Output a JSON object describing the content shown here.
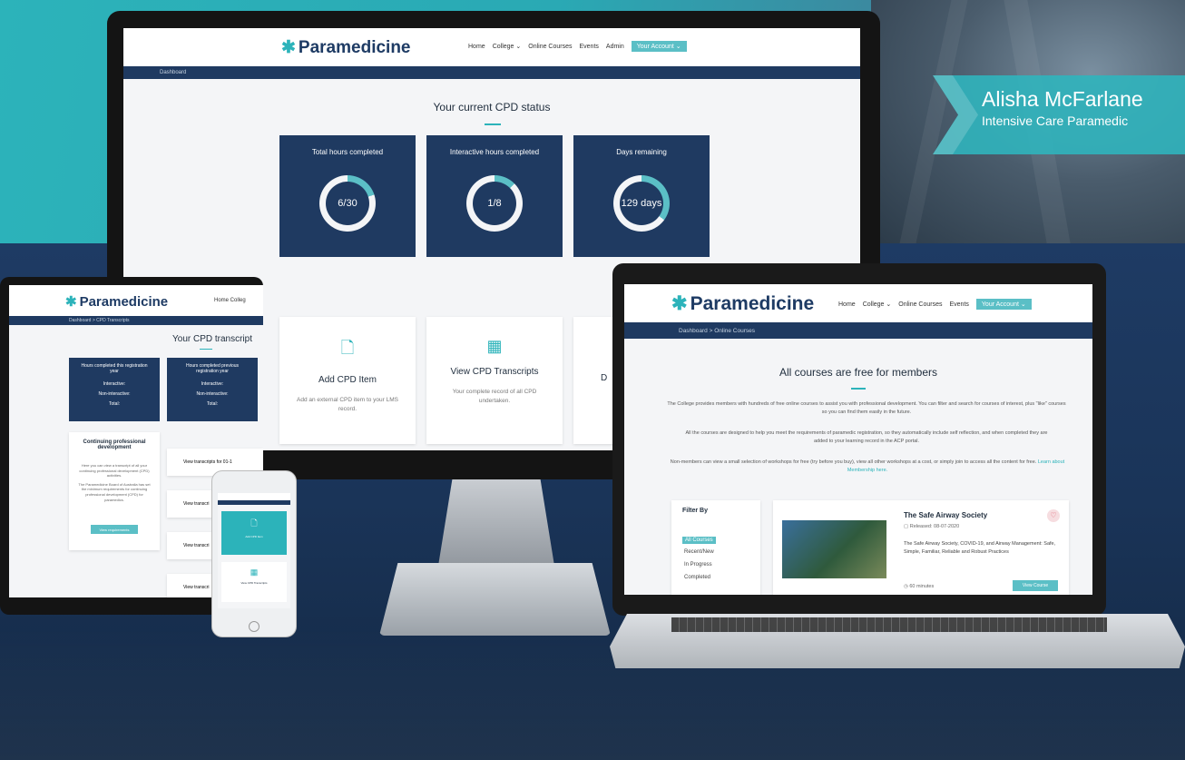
{
  "hero": {
    "name": "Alisha McFarlane",
    "role": "Intensive Care Paramedic"
  },
  "desktop": {
    "logo": "Paramedicine",
    "nav": [
      "Home",
      "College ⌄",
      "Online Courses",
      "Events",
      "Admin"
    ],
    "account": "Your Account ⌄",
    "breadcrumb": "Dashboard",
    "heading": "Your current CPD status",
    "tiles": [
      {
        "title": "Total hours completed",
        "value": "6/30",
        "progress": 0.2
      },
      {
        "title": "Interactive hours completed",
        "value": "1/8",
        "progress": 0.125
      },
      {
        "title": "Days remaining",
        "value": "129 days",
        "progress": 0.35
      }
    ],
    "cards": [
      {
        "title": "Add CPD Item",
        "desc": "Add an external CPD item to your LMS record."
      },
      {
        "title": "View CPD Transcripts",
        "desc": "Your complete record of all CPD undertaken."
      },
      {
        "title": "D",
        "desc": ""
      }
    ]
  },
  "tablet": {
    "logo": "Paramedicine",
    "nav": "Home  Colleg",
    "breadcrumb": "Dashboard  >  CPD Transcripts",
    "heading": "Your CPD transcript",
    "box1": "Hours completed this registration year",
    "box2": "Hours completed previous registration year",
    "rows": [
      "Interactive:",
      "Non-interactive:",
      "Total:"
    ],
    "side_title": "Continuing professional development",
    "side_text1": "Here you can view a transcript of all your continuing professional development (CPD) activities.",
    "side_text2": "The Paramedicine Board of Australia has set the minimum requirements for continuing professional development (CPD) for paramedics.",
    "side_btn": "View requirements",
    "links": [
      "View transcripts for 01-1",
      "View transcri",
      "View transcri",
      "View transcri"
    ]
  },
  "phone": {
    "item1": "Add CPD Item",
    "item2": "View CPD Transcripts"
  },
  "laptop": {
    "logo": "Paramedicine",
    "nav": [
      "Home",
      "College ⌄",
      "Online Courses",
      "Events"
    ],
    "account": "Your Account ⌄",
    "breadcrumb": "Dashboard  >  Online Courses",
    "heading": "All courses are free for members",
    "p1": "The College provides members with hundreds of free online courses to assist you with professional development. You can filter and search for courses of interest, plus \"like\" courses so you can find them easily in the future.",
    "p2": "All the courses are designed to help you meet the requirements of paramedic registration, so they automatically include self reflection, and when completed they are added to your learning record in the ACP portal.",
    "p3": "Non-members can view a small selection of workshops for free (try before you buy), view all other workshops at a cost, or simply join to access all the content for free.",
    "p3_link": "Learn about Membership here.",
    "filter_title": "Filter By",
    "filters": [
      "All Courses",
      "Recent/New",
      "In Progress",
      "Completed"
    ],
    "course_title": "The Safe Airway Society",
    "course_date": "Released: 08-07-2020",
    "course_desc": "The Safe Airway Society, COVID-19, and Airway Management: Safe, Simple, Familiar, Reliable and Robust Practices",
    "course_duration": "60 minutes",
    "course_btn": "View Course"
  },
  "colors": {
    "teal": "#2cb3ba",
    "navy": "#1f3a61"
  }
}
